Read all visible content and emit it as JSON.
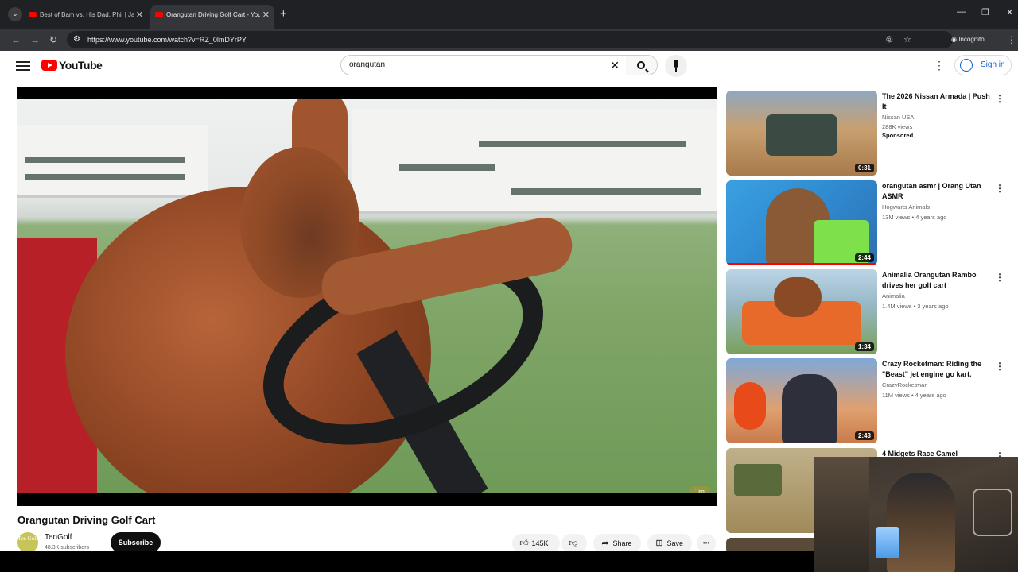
{
  "browser": {
    "tabs": [
      {
        "label": "Best of Bam vs. His Dad, Phil | Jackass",
        "active": false
      },
      {
        "label": "Orangutan Driving Golf Cart - YouTube",
        "active": true
      }
    ],
    "url": "https://www.youtube.com/watch?v=RZ_0lmDYrPY",
    "incognito_label": "Incognito",
    "new_tab_label": "+",
    "minimize_label": "—",
    "maximize_label": "❐",
    "close_label": "✕"
  },
  "youtube": {
    "logo_text": "YouTube",
    "search": {
      "value": "orangutan",
      "clear": "✕"
    },
    "sign_in": "Sign in",
    "more": "⋮"
  },
  "video": {
    "title": "Orangutan Driving Golf Cart",
    "watermark": "Ten Golf",
    "channel": {
      "avatar_text": "Ten Golf",
      "name": "TenGolf",
      "subscribers": "48.3K subscribers"
    },
    "subscribe": "Subscribe",
    "actions": {
      "likes": "145K",
      "share": "Share",
      "save": "Save",
      "more": "•••"
    }
  },
  "sidebar": {
    "items": [
      {
        "title": "The 2026 Nissan Armada | Push It",
        "channel": "Nissan USA",
        "meta": "288K views",
        "sponsored": "Sponsored",
        "duration": "0:31"
      },
      {
        "title": "orangutan asmr | Orang Utan ASMR",
        "channel": "Hogwarts Animals",
        "meta": "13M views • 4 years ago",
        "duration": "2:44"
      },
      {
        "title": "Animalia Orangutan Rambo drives her golf cart",
        "channel": "Animalia",
        "meta": "1.4M views • 3 years ago",
        "duration": "1:34"
      },
      {
        "title": "Crazy Rocketman: Riding the \"Beast\" jet engine go kart.",
        "channel": "CrazyRocketman",
        "meta": "11M views • 4 years ago",
        "duration": "2:43"
      },
      {
        "title": "4 Midgets Race Camel"
      }
    ]
  },
  "colors": {
    "brand": "#ff0000",
    "link": "#065fd4",
    "chrome_dark": "#202124"
  }
}
